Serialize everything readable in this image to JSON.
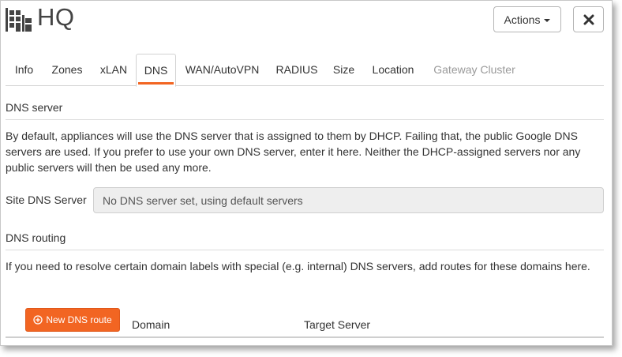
{
  "header": {
    "title": "HQ",
    "site_icon": "building-icon",
    "actions_label": "Actions",
    "close_icon": "close-icon"
  },
  "tabs": [
    {
      "label": "Info"
    },
    {
      "label": "Zones"
    },
    {
      "label": "xLAN"
    },
    {
      "label": "DNS",
      "active": true
    },
    {
      "label": "WAN/AutoVPN"
    },
    {
      "label": "RADIUS"
    },
    {
      "label": "Size"
    },
    {
      "label": "Location"
    },
    {
      "label": "Gateway Cluster",
      "disabled": true
    }
  ],
  "dns_server": {
    "title": "DNS server",
    "description": "By default, appliances will use the DNS server that is assigned to them by DHCP. Failing that, the public Google DNS servers are used. If you prefer to use your own DNS server, enter it here. Neither the DHCP-assigned servers nor any public servers will then be used any more.",
    "field_label": "Site DNS Server",
    "field_value": "",
    "field_placeholder": "No DNS server set, using default servers"
  },
  "dns_routing": {
    "title": "DNS routing",
    "description": "If you need to resolve certain domain labels with special (e.g. internal) DNS servers, add routes for these domains here.",
    "new_route_label": "New DNS route",
    "new_route_icon": "plus-circle-icon",
    "columns": [
      "Domain",
      "Target Server"
    ]
  },
  "colors": {
    "accent": "#f26522",
    "disabled_text": "#999999",
    "input_background": "#eeeeee"
  }
}
